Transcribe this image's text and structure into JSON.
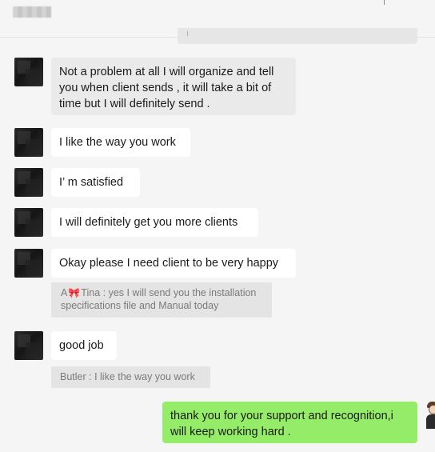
{
  "header": {
    "contact_name": ""
  },
  "messages": [
    {
      "id": "m1",
      "sender": "contact",
      "text": "Not a problem at all I will organize and tell you when client sends , it will take a bit of time but I will definitely send ."
    },
    {
      "id": "m2",
      "sender": "contact",
      "text": "I like the way you work"
    },
    {
      "id": "m3",
      "sender": "contact",
      "text": "I’ m satisfied"
    },
    {
      "id": "m4",
      "sender": "contact",
      "text": "I will definitely get you more clients"
    },
    {
      "id": "m5",
      "sender": "contact",
      "text": "Okay please I need client to be very happy",
      "quote": {
        "prefix": "A",
        "icon": "bow-icon",
        "rest": "Tina : yes I will send you the installation specifications file and Manual today"
      }
    },
    {
      "id": "m6",
      "sender": "contact",
      "text": "good job",
      "quote": {
        "text": "Butler : I like the way you work"
      }
    },
    {
      "id": "m7",
      "sender": "me",
      "text": "thank you for your support and recognition,i will keep working hard ."
    }
  ],
  "colors": {
    "background": "#f5f5f5",
    "incoming_bubble": "#ffffff",
    "outgoing_bubble": "#95ec69",
    "quote_bg": "#e4e4e4",
    "quote_text": "#7a7a7a"
  }
}
